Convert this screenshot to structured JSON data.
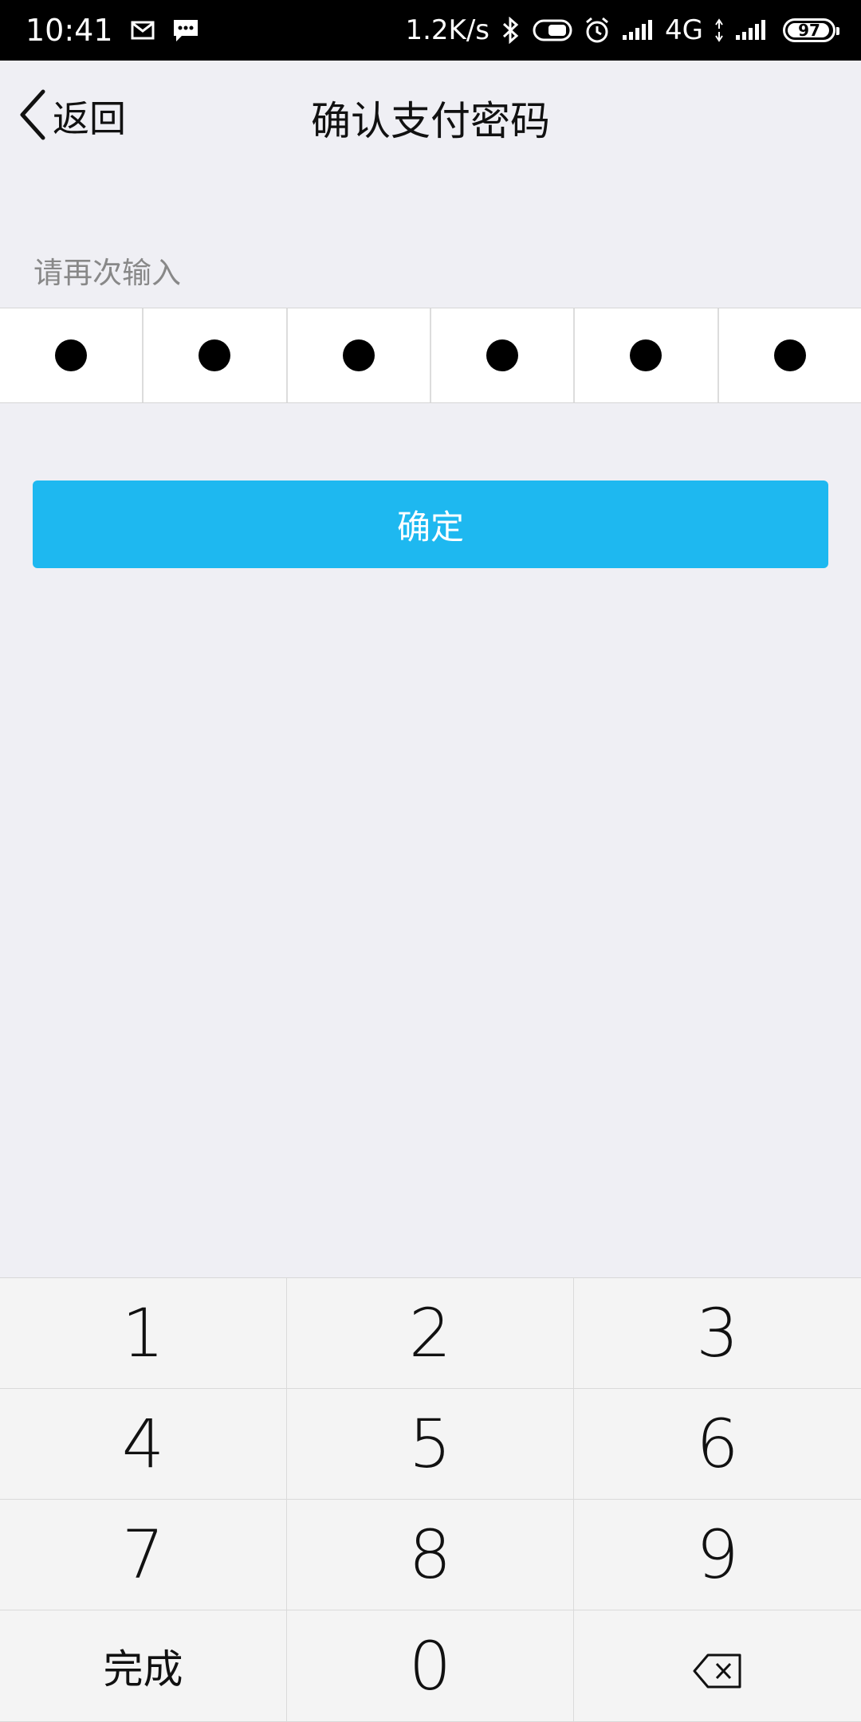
{
  "status_bar": {
    "time": "10:41",
    "speed": "1.2K/s",
    "network": "4G",
    "battery_level": "97",
    "icons": [
      "mail-icon",
      "message-icon",
      "bluetooth-icon",
      "toggle-icon",
      "alarm-icon",
      "signal-icon",
      "signal-icon-2"
    ]
  },
  "nav": {
    "back_label": "返回",
    "title": "确认支付密码"
  },
  "prompt": "请再次输入",
  "pin": {
    "length": 6,
    "filled": 6
  },
  "confirm_label": "确定",
  "keypad": {
    "keys": [
      "1",
      "2",
      "3",
      "4",
      "5",
      "6",
      "7",
      "8",
      "9",
      "完成",
      "0",
      ""
    ]
  },
  "colors": {
    "accent": "#1eb8f0",
    "background": "#efeff4",
    "keypad_bg": "#f4f4f4"
  }
}
